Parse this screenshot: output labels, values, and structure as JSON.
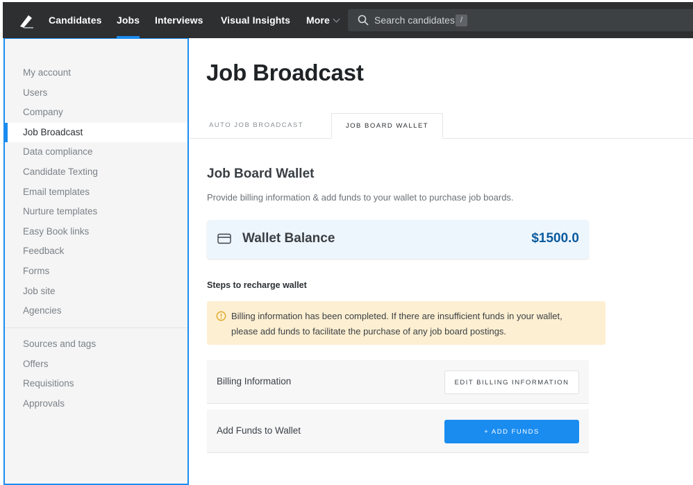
{
  "nav": {
    "logo": "pencil-logo",
    "items": [
      {
        "label": "Candidates"
      },
      {
        "label": "Jobs"
      },
      {
        "label": "Interviews"
      },
      {
        "label": "Visual Insights"
      },
      {
        "label": "More"
      }
    ],
    "active": "Jobs",
    "search": {
      "placeholder": "Search candidates",
      "shortcut": "/"
    }
  },
  "sidebar": {
    "items": [
      {
        "label": "My account"
      },
      {
        "label": "Users"
      },
      {
        "label": "Company"
      },
      {
        "label": "Job Broadcast"
      },
      {
        "label": "Data compliance"
      },
      {
        "label": "Candidate Texting"
      },
      {
        "label": "Email templates"
      },
      {
        "label": "Nurture templates"
      },
      {
        "label": "Easy Book links"
      },
      {
        "label": "Feedback"
      },
      {
        "label": "Forms"
      },
      {
        "label": "Job site"
      },
      {
        "label": "Agencies"
      }
    ],
    "items2": [
      {
        "label": "Sources and tags"
      },
      {
        "label": "Offers"
      },
      {
        "label": "Requisitions"
      },
      {
        "label": "Approvals"
      }
    ],
    "active": "Job Broadcast"
  },
  "main": {
    "title": "Job Broadcast",
    "tabs": [
      {
        "label": "AUTO JOB BROADCAST"
      },
      {
        "label": "JOB BOARD WALLET"
      }
    ],
    "active_tab": "JOB BOARD WALLET",
    "section_title": "Job Board Wallet",
    "section_desc": "Provide billing information & add funds to your wallet to purchase job boards.",
    "wallet": {
      "label": "Wallet Balance",
      "amount": "$1500.0"
    },
    "steps_title": "Steps to recharge wallet",
    "notice_lines": [
      "Billing information has been completed. If there are insufficient funds in your wallet,",
      "please add funds to facilitate the purchase of any job board postings."
    ],
    "rows": [
      {
        "label": "Billing Information",
        "button": "EDIT BILLING INFORMATION"
      },
      {
        "label": "Add Funds to Wallet",
        "button": "+ ADD FUNDS"
      }
    ]
  },
  "colors": {
    "nav_bg": "#2d2f31",
    "accent": "#1a8cf0",
    "amount": "#0b5a9e",
    "notice_bg": "#fdefd1",
    "card_bg": "#eef6fd"
  }
}
